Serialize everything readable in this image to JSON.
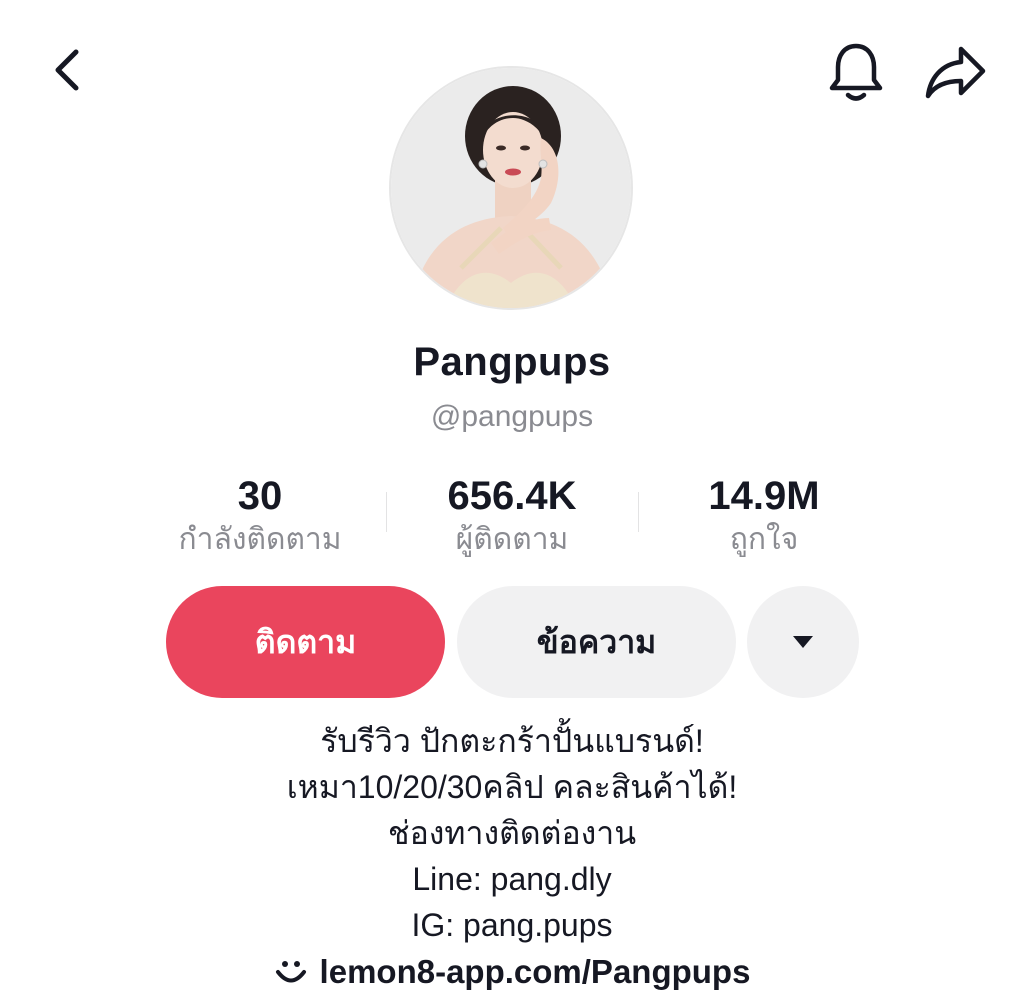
{
  "header": {
    "back_icon": "chevron-left-icon",
    "notification_icon": "bell-icon",
    "share_icon": "share-arrow-icon"
  },
  "profile": {
    "display_name": "Pangpups",
    "username": "@pangpups"
  },
  "stats": [
    {
      "value": "30",
      "label": "กำลังติดตาม"
    },
    {
      "value": "656.4K",
      "label": "ผู้ติดตาม"
    },
    {
      "value": "14.9M",
      "label": "ถูกใจ"
    }
  ],
  "actions": {
    "follow_label": "ติดตาม",
    "message_label": "ข้อความ",
    "more_icon": "caret-down-icon"
  },
  "bio": {
    "lines": [
      "รับรีวิว ปักตะกร้าปั้นแบรนด์!",
      "เหมา10/20/30คลิป คละสินค้าได้!",
      "ช่องทางติดต่องาน",
      "Line: pang.dly",
      "IG: pang.pups"
    ],
    "link_icon": "lemon8-icon",
    "link_text": "lemon8-app.com/Pangpups"
  },
  "colors": {
    "follow_button": "#ea455d",
    "secondary_button": "#f1f1f2",
    "text_primary": "#161823",
    "text_secondary": "#8a8b91"
  }
}
